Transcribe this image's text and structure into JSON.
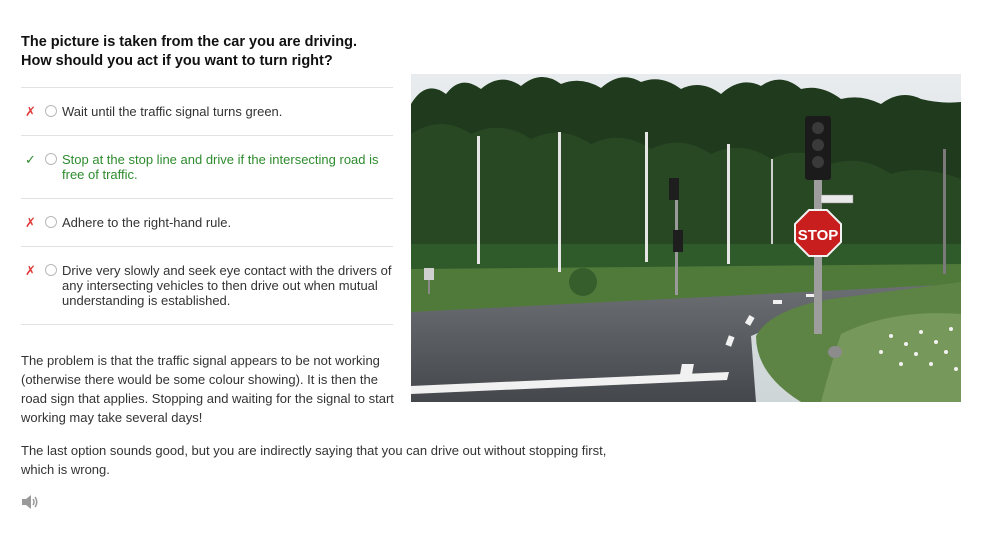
{
  "question": {
    "line1": "The picture is taken from the car you are driving.",
    "line2": "How should you act if you want to turn right?"
  },
  "options": [
    {
      "mark": "✗",
      "text": "Wait until the traffic signal turns green.",
      "status": "wrong"
    },
    {
      "mark": "✓",
      "text": "Stop at the stop line and drive if the intersecting road is free of traffic.",
      "status": "correct"
    },
    {
      "mark": "✗",
      "text": "Adhere to the right-hand rule.",
      "status": "wrong"
    },
    {
      "mark": "✗",
      "text": "Drive very slowly and seek eye contact with the drivers of any intersecting vehicles to then drive out when mutual understanding is established.",
      "status": "wrong"
    }
  ],
  "photo": {
    "stop_sign_text": "STOP"
  },
  "explanation": {
    "paragraph1": "The problem is that the traffic signal appears to be not working (otherwise there would be some colour showing). It is then the road sign that applies. Stopping and waiting for the signal to start working may take several days!",
    "paragraph2": "The last option sounds good, but you are indirectly saying that you can drive out without stopping first, which is wrong."
  },
  "audio": {
    "icon": "speaker-icon"
  },
  "colors": {
    "correct": "#2e8b2e",
    "wrong": "#e03a3a"
  }
}
